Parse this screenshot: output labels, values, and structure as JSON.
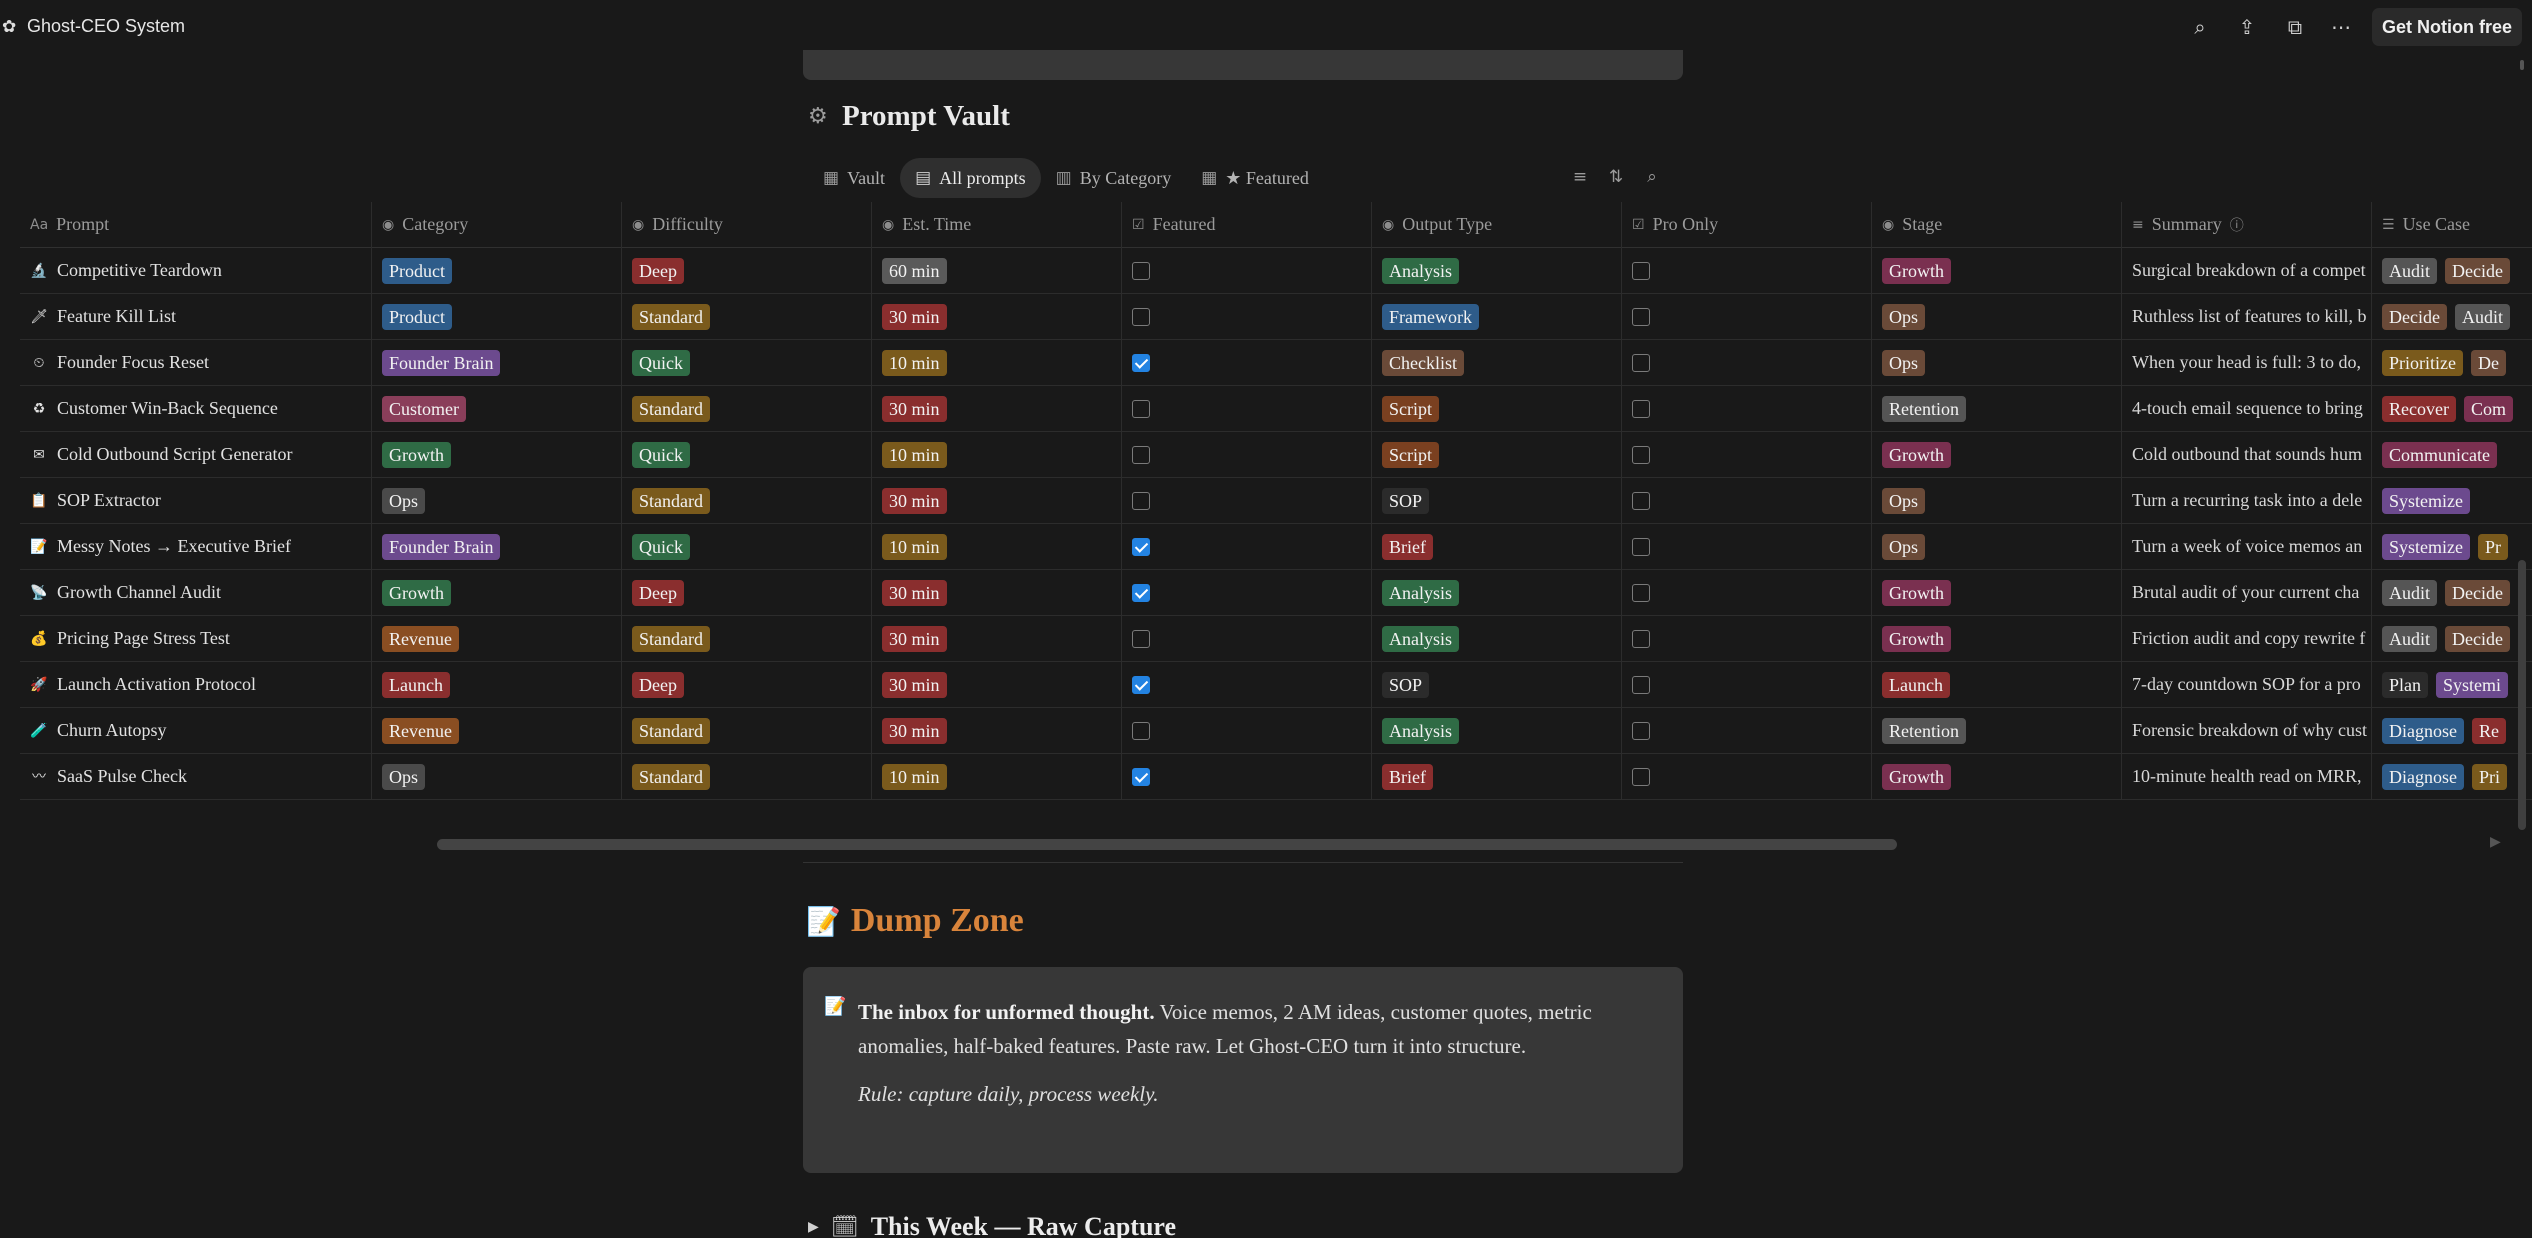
{
  "topbar": {
    "workspace_icon": "notion-workspace-icon",
    "title": "Ghost-CEO System",
    "icons": [
      "search-icon",
      "share-icon",
      "duplicate-icon",
      "more-icon"
    ],
    "cta": "Get Notion free"
  },
  "database": {
    "icon": "gear-icon",
    "title": "Prompt Vault",
    "views": [
      {
        "label": "Vault",
        "icon": "gallery-icon",
        "glyph": "▦",
        "active": false
      },
      {
        "label": "All prompts",
        "icon": "table-icon",
        "glyph": "▤",
        "active": true
      },
      {
        "label": "By Category",
        "icon": "board-icon",
        "glyph": "▥",
        "active": false
      },
      {
        "label": "★ Featured",
        "icon": "gallery-icon",
        "glyph": "▦",
        "active": false
      }
    ],
    "tools": [
      "filter-icon",
      "sort-icon",
      "search-icon"
    ],
    "columns": [
      {
        "label": "Prompt",
        "icon": "text-property-icon",
        "glyph": "Aa"
      },
      {
        "label": "Category",
        "icon": "select-property-icon",
        "glyph": "◉"
      },
      {
        "label": "Difficulty",
        "icon": "select-property-icon",
        "glyph": "◉"
      },
      {
        "label": "Est. Time",
        "icon": "select-property-icon",
        "glyph": "◉"
      },
      {
        "label": "Featured",
        "icon": "checkbox-property-icon",
        "glyph": "☑"
      },
      {
        "label": "Output Type",
        "icon": "select-property-icon",
        "glyph": "◉"
      },
      {
        "label": "Pro Only",
        "icon": "checkbox-property-icon",
        "glyph": "☑"
      },
      {
        "label": "Stage",
        "icon": "select-property-icon",
        "glyph": "◉"
      },
      {
        "label": "Summary",
        "icon": "text-property-icon",
        "glyph": "≡",
        "info": "ⓘ"
      },
      {
        "label": "Use Case",
        "icon": "multiselect-property-icon",
        "glyph": "☰"
      }
    ],
    "rows": [
      {
        "icon": "microscope-icon",
        "glyph": "🔬",
        "prompt": "Competitive Teardown",
        "category": "Product",
        "difficulty": "Deep",
        "time": "60 min",
        "featured": false,
        "output": "Analysis",
        "pro": false,
        "stage": "Growth",
        "summary": "Surgical breakdown of a compet",
        "use_case": [
          "Audit",
          "Decide"
        ]
      },
      {
        "icon": "knife-icon",
        "glyph": "🗡",
        "prompt": "Feature Kill List",
        "category": "Product",
        "difficulty": "Standard",
        "time": "30 min",
        "featured": false,
        "output": "Framework",
        "pro": false,
        "stage": "Ops",
        "summary": "Ruthless list of features to kill, b",
        "use_case": [
          "Decide",
          "Audit"
        ]
      },
      {
        "icon": "clock-icon",
        "glyph": "⏲",
        "prompt": "Founder Focus Reset",
        "category": "Founder Brain",
        "difficulty": "Quick",
        "time": "10 min",
        "featured": true,
        "output": "Checklist",
        "pro": false,
        "stage": "Ops",
        "summary": "When your head is full: 3 to do,",
        "use_case": [
          "Prioritize",
          "De"
        ]
      },
      {
        "icon": "recycle-icon",
        "glyph": "♻",
        "prompt": "Customer Win-Back Sequence",
        "category": "Customer",
        "difficulty": "Standard",
        "time": "30 min",
        "featured": false,
        "output": "Script",
        "pro": false,
        "stage": "Retention",
        "summary": "4-touch email sequence to bring",
        "use_case": [
          "Recover",
          "Com"
        ]
      },
      {
        "icon": "email-icon",
        "glyph": "✉",
        "prompt": "Cold Outbound Script Generator",
        "category": "Growth",
        "difficulty": "Quick",
        "time": "10 min",
        "featured": false,
        "output": "Script",
        "pro": false,
        "stage": "Growth",
        "summary": "Cold outbound that sounds hum",
        "use_case": [
          "Communicate"
        ]
      },
      {
        "icon": "clipboard-icon",
        "glyph": "📋",
        "prompt": "SOP Extractor",
        "category": "Ops",
        "difficulty": "Standard",
        "time": "30 min",
        "featured": false,
        "output": "SOP",
        "pro": false,
        "stage": "Ops",
        "summary": "Turn a recurring task into a dele",
        "use_case": [
          "Systemize"
        ]
      },
      {
        "icon": "memo-icon",
        "glyph": "📝",
        "prompt": "Messy Notes → Executive Brief",
        "category": "Founder Brain",
        "difficulty": "Quick",
        "time": "10 min",
        "featured": true,
        "output": "Brief",
        "pro": false,
        "stage": "Ops",
        "summary": "Turn a week of voice memos an",
        "use_case": [
          "Systemize",
          "Pr"
        ]
      },
      {
        "icon": "satellite-icon",
        "glyph": "📡",
        "prompt": "Growth Channel Audit",
        "category": "Growth",
        "difficulty": "Deep",
        "time": "30 min",
        "featured": true,
        "output": "Analysis",
        "pro": false,
        "stage": "Growth",
        "summary": "Brutal audit of your current cha",
        "use_case": [
          "Audit",
          "Decide"
        ]
      },
      {
        "icon": "money-bag-icon",
        "glyph": "💰",
        "prompt": "Pricing Page Stress Test",
        "category": "Revenue",
        "difficulty": "Standard",
        "time": "30 min",
        "featured": false,
        "output": "Analysis",
        "pro": false,
        "stage": "Growth",
        "summary": "Friction audit and copy rewrite f",
        "use_case": [
          "Audit",
          "Decide"
        ]
      },
      {
        "icon": "rocket-icon",
        "glyph": "🚀",
        "prompt": "Launch Activation Protocol",
        "category": "Launch",
        "difficulty": "Deep",
        "time": "30 min",
        "featured": true,
        "output": "SOP",
        "pro": false,
        "stage": "Launch",
        "summary": "7-day countdown SOP for a pro",
        "use_case": [
          "Plan",
          "Systemi"
        ]
      },
      {
        "icon": "test-tube-icon",
        "glyph": "🧪",
        "prompt": "Churn Autopsy",
        "category": "Revenue",
        "difficulty": "Standard",
        "time": "30 min",
        "featured": false,
        "output": "Analysis",
        "pro": false,
        "stage": "Retention",
        "summary": "Forensic breakdown of why cust",
        "use_case": [
          "Diagnose",
          "Re"
        ]
      },
      {
        "icon": "pulse-icon",
        "glyph": "〰",
        "prompt": "SaaS Pulse Check",
        "category": "Ops",
        "difficulty": "Standard",
        "time": "10 min",
        "featured": true,
        "output": "Brief",
        "pro": false,
        "stage": "Growth",
        "summary": "10-minute health read on MRR,",
        "use_case": [
          "Diagnose",
          "Pri"
        ]
      }
    ]
  },
  "pill_colors": {
    "Product": "#2e5c8a",
    "Founder Brain": "#6c4a8e",
    "Customer": "#8a3e5a",
    "Growth": "#2f6b45",
    "Ops": "#4a4a4a",
    "Revenue": "#8a4e22",
    "Launch": "#8a2e2e",
    "Deep": "#8a2e2e",
    "Standard": "#7a5a1c",
    "Quick": "#2f6b45",
    "60 min": "#5a5a5a",
    "30 min": "#8a2e2e",
    "10 min": "#7a5a1c",
    "Analysis": "#2f6b45",
    "Framework": "#2e5c8a",
    "Checklist": "#6a4a38",
    "Script": "#7a4020",
    "SOP": "#2b2b2b",
    "Brief": "#8a2e2e",
    "Retention": "#555555",
    "Ops-stage": "#6a4a38",
    "Growth-stage": "#7a3050",
    "Launch-stage": "#8a2e2e",
    "Audit": "#555555",
    "Decide": "#6a4a38",
    "Prioritize": "#7a5a1c",
    "De": "#6a4a38",
    "Recover": "#8a2e2e",
    "Com": "#7a3050",
    "Communicate": "#7a3050",
    "Systemize": "#6c4a8e",
    "Pr": "#7a5a1c",
    "Plan": "#2b2b2b",
    "Systemi": "#6c4a8e",
    "Diagnose": "#2e5c8a",
    "Re": "#8a2e2e",
    "Pri": "#7a5a1c"
  },
  "dump_zone": {
    "emoji": "📝",
    "title": "Dump Zone",
    "callout_emoji": "📝",
    "lead": "The inbox for unformed thought.",
    "body": " Voice memos, 2 AM ideas, customer quotes, metric anomalies, half-baked features. Paste raw. Let Ghost-CEO turn it into structure.",
    "rule": "Rule: capture daily, process weekly."
  },
  "toggle": {
    "emoji": "🗓",
    "title": "This Week — Raw Capture"
  }
}
